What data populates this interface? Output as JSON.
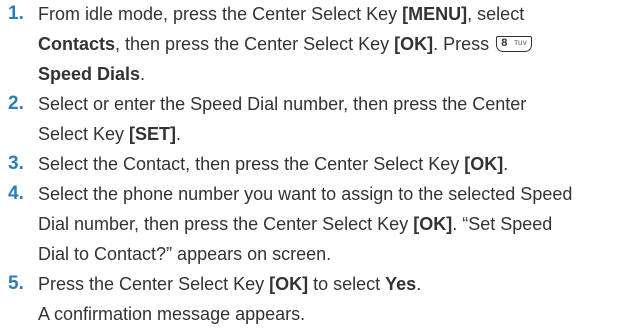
{
  "steps": [
    {
      "number": "1.",
      "parts": [
        {
          "t": "From idle mode, press the Center Select Key "
        },
        {
          "t": "[MENU]",
          "b": true
        },
        {
          "t": ", select "
        },
        {
          "br": true
        },
        {
          "t": "Contacts",
          "b": true
        },
        {
          "t": ", then press the Center Select Key "
        },
        {
          "t": "[OK]",
          "b": true
        },
        {
          "t": ". Press "
        },
        {
          "key": {
            "digit": "8",
            "letters": "TUV"
          }
        },
        {
          "br": true
        },
        {
          "t": "Speed Dials",
          "b": true
        },
        {
          "t": "."
        }
      ]
    },
    {
      "number": "2.",
      "parts": [
        {
          "t": "Select or enter the Speed Dial number, then press the Center"
        },
        {
          "br": true
        },
        {
          "t": "Select Key "
        },
        {
          "t": "[SET]",
          "b": true
        },
        {
          "t": "."
        }
      ]
    },
    {
      "number": "3.",
      "parts": [
        {
          "t": "Select the Contact, then press the Center Select Key "
        },
        {
          "t": "[OK]",
          "b": true
        },
        {
          "t": "."
        }
      ]
    },
    {
      "number": "4.",
      "parts": [
        {
          "t": "Select the phone number you want to assign to the selected Speed"
        },
        {
          "br": true
        },
        {
          "t": "Dial number, then press the Center Select Key "
        },
        {
          "t": "[OK]",
          "b": true
        },
        {
          "t": ". “Set Speed"
        },
        {
          "br": true
        },
        {
          "t": "Dial to Contact?” appears on screen."
        }
      ]
    },
    {
      "number": "5.",
      "parts": [
        {
          "t": "Press the Center Select Key "
        },
        {
          "t": "[OK]",
          "b": true
        },
        {
          "t": " to select "
        },
        {
          "t": "Yes",
          "b": true
        },
        {
          "t": "."
        },
        {
          "br": true
        },
        {
          "t": "A confirmation message appears."
        }
      ]
    }
  ],
  "colors": {
    "number": "#2a7dba",
    "text": "#333333"
  }
}
